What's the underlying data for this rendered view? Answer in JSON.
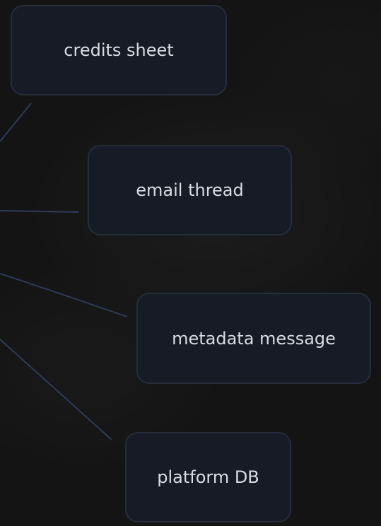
{
  "nodes": [
    {
      "id": "credits",
      "label": "credits sheet"
    },
    {
      "id": "email",
      "label": "email thread"
    },
    {
      "id": "metadata",
      "label": "metadata message"
    },
    {
      "id": "platform",
      "label": "platform DB"
    }
  ],
  "colors": {
    "background": "#141414",
    "node_fill": "#161b26",
    "node_border": "#262c3a",
    "node_text": "#d9dce3",
    "connector": "#2f3a55"
  }
}
